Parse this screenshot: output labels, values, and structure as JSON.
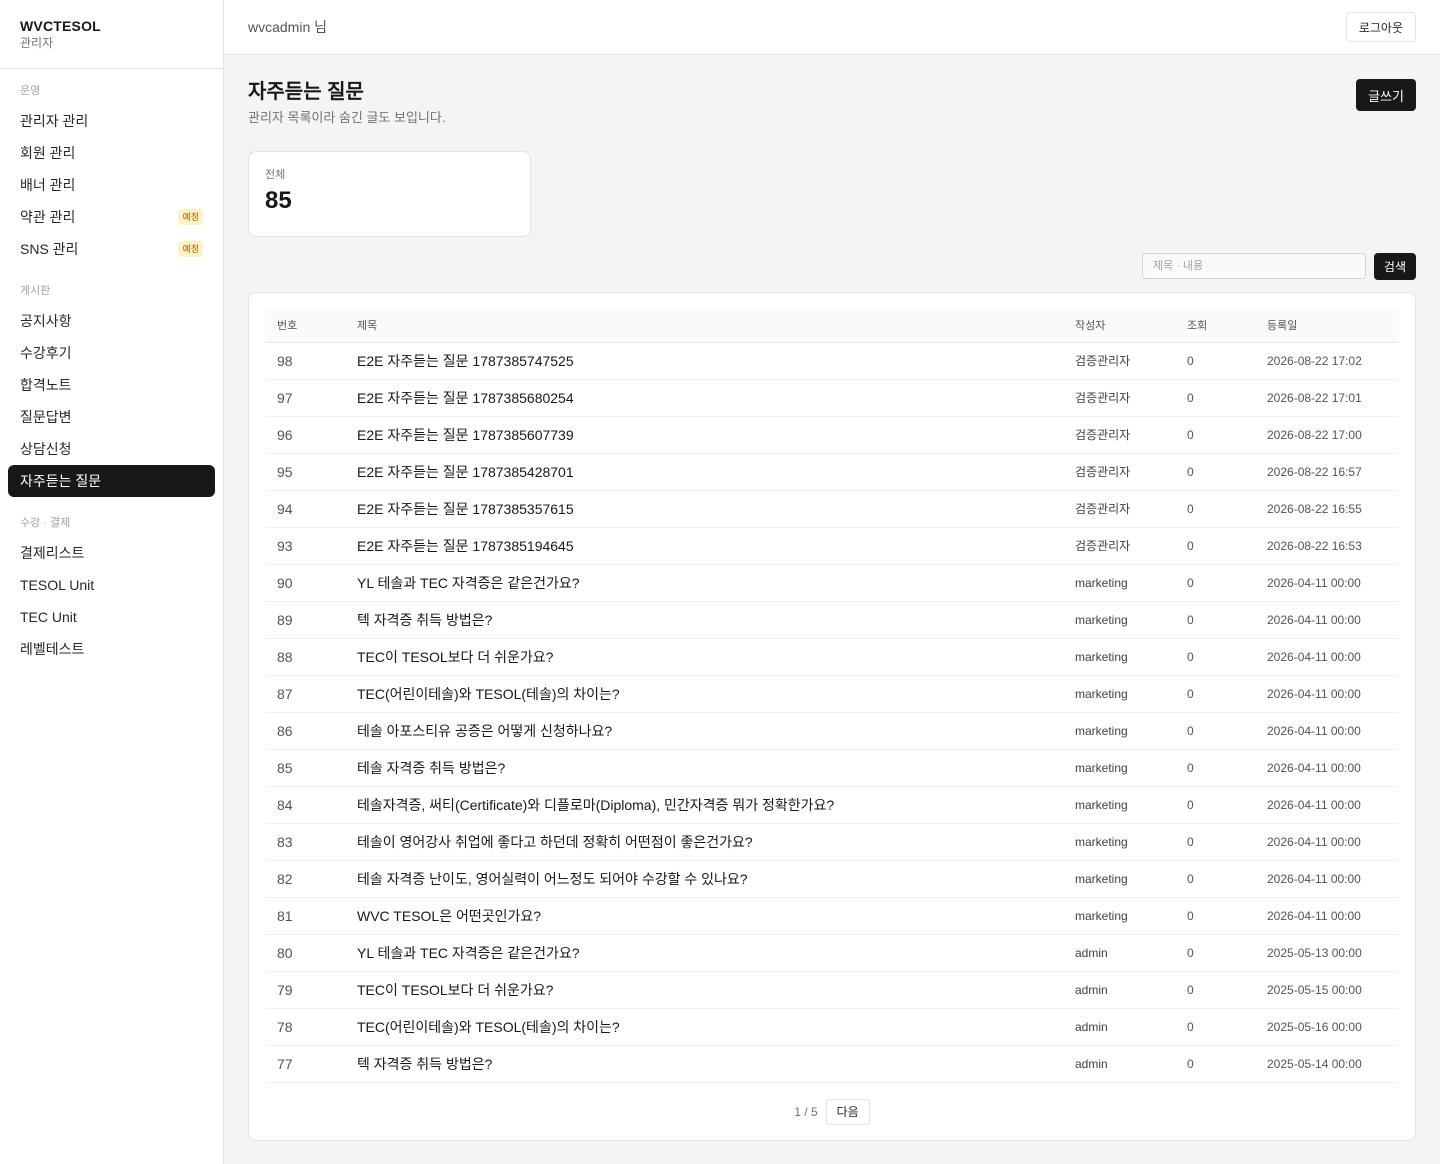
{
  "brand": {
    "name": "WVCTESOL",
    "sub": "관리자"
  },
  "sidebar": {
    "groups": [
      {
        "title": "운영",
        "items": [
          {
            "label": "관리자 관리",
            "badge": ""
          },
          {
            "label": "회원 관리",
            "badge": ""
          },
          {
            "label": "배너 관리",
            "badge": ""
          },
          {
            "label": "약관 관리",
            "badge": "예정"
          },
          {
            "label": "SNS 관리",
            "badge": "예정"
          }
        ]
      },
      {
        "title": "게시판",
        "items": [
          {
            "label": "공지사항",
            "badge": ""
          },
          {
            "label": "수강후기",
            "badge": ""
          },
          {
            "label": "합격노트",
            "badge": ""
          },
          {
            "label": "질문답변",
            "badge": ""
          },
          {
            "label": "상담신청",
            "badge": ""
          },
          {
            "label": "자주듣는 질문",
            "badge": "",
            "active": true
          }
        ]
      },
      {
        "title": "수강 · 결제",
        "items": [
          {
            "label": "결제리스트",
            "badge": ""
          },
          {
            "label": "TESOL Unit",
            "badge": ""
          },
          {
            "label": "TEC Unit",
            "badge": ""
          },
          {
            "label": "레벨테스트",
            "badge": ""
          }
        ]
      }
    ]
  },
  "header": {
    "user": "wvcadmin 님",
    "logout_label": "로그아웃"
  },
  "page": {
    "title": "자주듣는 질문",
    "description": "관리자 목록이라 숨긴 글도 보입니다.",
    "write_label": "글쓰기"
  },
  "stats": {
    "total_label": "전체",
    "total_value": "85"
  },
  "search": {
    "placeholder": "제목 · 내용",
    "value": "",
    "button_label": "검색"
  },
  "table": {
    "columns": [
      "번호",
      "제목",
      "작성자",
      "조회",
      "등록일"
    ],
    "rows": [
      [
        "98",
        "E2E 자주듣는 질문 1787385747525",
        "검증관리자",
        "0",
        "2026-08-22 17:02"
      ],
      [
        "97",
        "E2E 자주듣는 질문 1787385680254",
        "검증관리자",
        "0",
        "2026-08-22 17:01"
      ],
      [
        "96",
        "E2E 자주듣는 질문 1787385607739",
        "검증관리자",
        "0",
        "2026-08-22 17:00"
      ],
      [
        "95",
        "E2E 자주듣는 질문 1787385428701",
        "검증관리자",
        "0",
        "2026-08-22 16:57"
      ],
      [
        "94",
        "E2E 자주듣는 질문 1787385357615",
        "검증관리자",
        "0",
        "2026-08-22 16:55"
      ],
      [
        "93",
        "E2E 자주듣는 질문 1787385194645",
        "검증관리자",
        "0",
        "2026-08-22 16:53"
      ],
      [
        "90",
        "YL 테솔과 TEC 자격증은 같은건가요?",
        "marketing",
        "0",
        "2026-04-11 00:00"
      ],
      [
        "89",
        "텍 자격증 취득 방법은?",
        "marketing",
        "0",
        "2026-04-11 00:00"
      ],
      [
        "88",
        "TEC이 TESOL보다 더 쉬운가요?",
        "marketing",
        "0",
        "2026-04-11 00:00"
      ],
      [
        "87",
        "TEC(어린이테솔)와 TESOL(테솔)의 차이는?",
        "marketing",
        "0",
        "2026-04-11 00:00"
      ],
      [
        "86",
        "테솔 아포스티유 공증은 어떻게 신청하나요?",
        "marketing",
        "0",
        "2026-04-11 00:00"
      ],
      [
        "85",
        "테솔 자격증 취득 방법은?",
        "marketing",
        "0",
        "2026-04-11 00:00"
      ],
      [
        "84",
        "테솔자격증, 써티(Certificate)와 디플로마(Diploma), 민간자격증 뭐가 정확한가요?",
        "marketing",
        "0",
        "2026-04-11 00:00"
      ],
      [
        "83",
        "테솔이 영어강사 취업에 좋다고 하던데 정확히 어떤점이 좋은건가요?",
        "marketing",
        "0",
        "2026-04-11 00:00"
      ],
      [
        "82",
        "테솔 자격증 난이도, 영어실력이 어느정도 되어야 수강할 수 있나요?",
        "marketing",
        "0",
        "2026-04-11 00:00"
      ],
      [
        "81",
        "WVC TESOL은 어떤곳인가요?",
        "marketing",
        "0",
        "2026-04-11 00:00"
      ],
      [
        "80",
        "YL 테솔과 TEC 자격증은 같은건가요?",
        "admin",
        "0",
        "2025-05-13 00:00"
      ],
      [
        "79",
        "TEC이 TESOL보다 더 쉬운가요?",
        "admin",
        "0",
        "2025-05-15 00:00"
      ],
      [
        "78",
        "TEC(어린이테솔)와 TESOL(테솔)의 차이는?",
        "admin",
        "0",
        "2025-05-16 00:00"
      ],
      [
        "77",
        "텍 자격증 취득 방법은?",
        "admin",
        "0",
        "2025-05-14 00:00"
      ]
    ]
  },
  "pagination": {
    "info": "1 / 5",
    "next_label": "다음"
  }
}
